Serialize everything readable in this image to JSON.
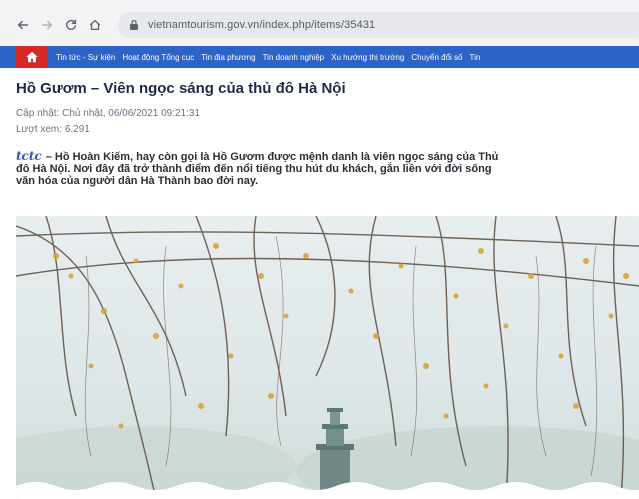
{
  "browser": {
    "back_icon": "arrow-left-icon",
    "forward_icon": "arrow-right-icon",
    "reload_icon": "reload-icon",
    "home_icon": "home-icon",
    "url": "vietnamtourism.gov.vn/index.php/items/35431"
  },
  "site_nav": {
    "home_icon": "home-icon",
    "items": [
      "Tin tức - Sự kiện",
      "Hoạt động Tổng cục",
      "Tin địa phương",
      "Tin doanh nghiệp",
      "Xu hướng thị trường",
      "Chuyển đổi số",
      "Tin"
    ]
  },
  "article": {
    "title": "Hồ Gươm – Viên ngọc sáng của thủ đô Hà Nội",
    "date": "Cập nhật: Chủ nhật, 06/06/2021 09:21:31",
    "views": "Lượt xem: 6.291",
    "lead_logo": "tctc",
    "lead_lines": [
      "– Hồ Hoàn Kiếm, hay còn gọi là Hồ Gươm được mệnh danh là viên ngọc sáng của Thủ",
      "đô Hà Nội. Nơi đây đã trở thành điểm đến nổi tiếng thu hút du khách, gắn liền với đời sống",
      "văn hóa của người dân Hà Thành bao đời nay."
    ]
  },
  "colors": {
    "nav_blue": "#2c63c6",
    "home_red": "#d62a2a",
    "title": "#1f2a44"
  }
}
